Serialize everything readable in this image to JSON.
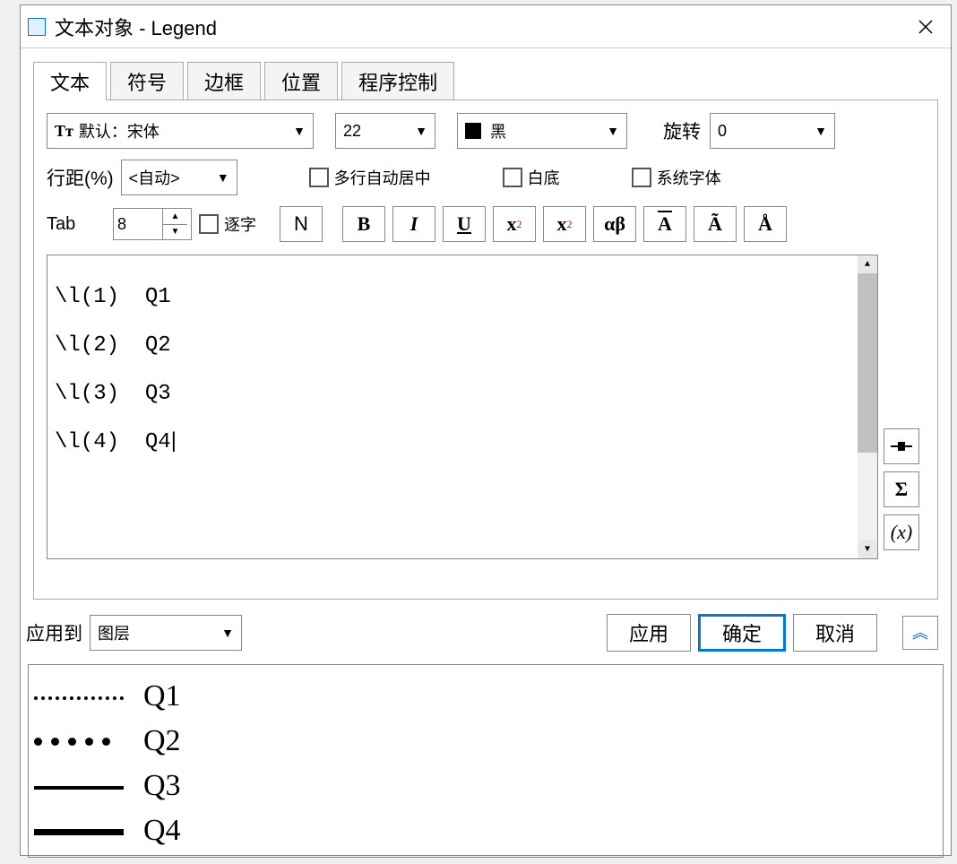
{
  "window": {
    "title": "文本对象 - Legend"
  },
  "tabs": {
    "text": "文本",
    "symbol": "符号",
    "frame": "边框",
    "position": "位置",
    "program": "程序控制"
  },
  "font": {
    "family_label": "默认：宋体",
    "size": "22",
    "color_label": "黑",
    "rotate_label": "旋转",
    "rotate_value": "0"
  },
  "linespacing": {
    "label": "行距(%)",
    "value": "<自动>"
  },
  "options": {
    "multiline_center": "多行自动居中",
    "white_bg": "白底",
    "system_font": "系统字体"
  },
  "tab_setting": {
    "label": "Tab",
    "value": "8",
    "per_char": "逐字"
  },
  "format_buttons": {
    "normal": "N",
    "bold": "B",
    "italic": "I",
    "underline": "U",
    "super_base": "x",
    "sub_base": "x",
    "greek": "αβ",
    "overline": "A",
    "tilde": "Ã",
    "dot": "Å"
  },
  "textarea_lines": [
    "\\l(1)  Q1",
    "\\l(2)  Q2",
    "\\l(3)  Q3",
    "\\l(4)  Q4"
  ],
  "side_buttons": {
    "insert_symbol": "▪",
    "sigma": "Σ",
    "variable": "(x)"
  },
  "apply_to": {
    "label": "应用到",
    "value": "图层"
  },
  "buttons": {
    "apply": "应用",
    "ok": "确定",
    "cancel": "取消"
  },
  "legend_preview": [
    "Q1",
    "Q2",
    "Q3",
    "Q4"
  ]
}
